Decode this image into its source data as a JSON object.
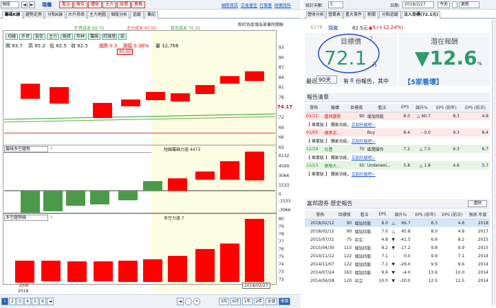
{
  "app": {
    "stock_name": "瑞儀",
    "mkt_label": "個股",
    "arrow_buttons": [
      "◄",
      "►"
    ],
    "red_buttons": [
      "看法",
      "報告",
      "體檢",
      "主力",
      "股價",
      "氣報"
    ],
    "links": [
      "國際資訊",
      "交易量佳",
      "行事曆",
      "財團資料"
    ]
  },
  "left_tabs": [
    "籌碼K線",
    "趨勢走勢",
    "分點K線",
    "大戶券商",
    "主力地圖",
    "個股分析",
    "追蹤",
    "筆記"
  ],
  "chart_legend": {
    "items": [
      "外資成本 68.70",
      "主力成本 65.50",
      "投信成本 70.31"
    ],
    "note": "粉紅色區塊為單筆所關聯"
  },
  "chart_buttons": [
    "均線",
    "外資",
    "投信",
    "主力",
    "融資",
    "布林",
    "籌碼",
    "紅綠燈",
    "設"
  ],
  "ohlc": {
    "open": "開 83.7",
    "high": "高 85.2",
    "low": "低 82.5",
    "close": "收 82.5",
    "chg": "漲跌 0.3",
    "pct": "漲幅 0.36%",
    "vol": "量 12,768",
    "tip": "90.00"
  },
  "price_axis": [
    "93",
    "90",
    "87",
    "84",
    "81",
    "78",
    "72",
    "69",
    "66",
    "63"
  ],
  "current_price": "74.17",
  "pane2": {
    "select": "籌碼多空趨勢",
    "legend": "短線籌碼力道 4473",
    "ticks": [
      "6132",
      "4599",
      "3066",
      "1533",
      "0",
      "-1533",
      "-3066"
    ]
  },
  "pane3": {
    "select": "多空趨勢線",
    "legend": "多空力道 7",
    "ticks": [
      "80",
      "79",
      "78",
      "77",
      "76",
      "75",
      "74",
      "73",
      "72"
    ]
  },
  "date_axis": {
    "left": "2/06",
    "left_year": "2018",
    "cursor": "2018/02/27"
  },
  "bottom": {
    "pages": [
      "1",
      "2",
      "3",
      "4",
      "5",
      "6"
    ],
    "ranges": [
      "3月",
      "6月",
      "1年",
      "2年",
      "全部",
      "復價"
    ],
    "misc": [
      "◄",
      "-",
      "+",
      "◄"
    ]
  },
  "right": {
    "stat_label": "統計天數:",
    "stat_value": "5",
    "date_label": "日期:",
    "date_value": "2018/2/27",
    "today_btn": "今天",
    "refresh_btn": "更新",
    "tabs": [
      "營收分析",
      "營業表",
      "重大事件",
      "新聞",
      "分點追蹤",
      "法人目標(72.1元)"
    ],
    "stock_line": {
      "code": "6176",
      "name": "瑞儀",
      "price": "82.5元",
      "change": "▲9 (+12.24%)"
    },
    "target_title": "目標價",
    "target_q": "?",
    "target_value": "72.1",
    "target_unit": "元",
    "upside_title": "潛在報酬",
    "upside_value": "▼12.6",
    "upside_unit": "%",
    "filter": {
      "recent": "最近",
      "days": "90天",
      "have": "有",
      "count": "8",
      "phrase": "份報告，其中",
      "buy_label": "【5家看壞】"
    },
    "report_list_title": "報告清單",
    "report_cols": [
      "發佈",
      "機構",
      "目標價",
      "看法",
      "EPS",
      "調升%",
      "EPS (前年)",
      "EPS (前次)"
    ],
    "reports": [
      {
        "date": "02/12",
        "org": "富邦證券",
        "target": "90",
        "view": "增加持股",
        "eps": "8.0",
        "arrow": "△",
        "chg": "66.7",
        "eps_prev_year": "8.3",
        "eps_prev": "4.8"
      },
      {
        "promo": "【 專業版 】 獨家功能，",
        "link": "立刻升級吧~"
      },
      {
        "date": "01/05",
        "org": "德意志...",
        "target": "",
        "view": "Buy",
        "eps": "8.4",
        "arrow": "-",
        "chg": "0.0",
        "eps_prev_year": "9.3",
        "eps_prev": "8.4"
      },
      {
        "promo": "【 專業版 】 獨家功能，",
        "link": "立刻升級吧~"
      },
      {
        "date": "12/28",
        "org": "兆豐",
        "target": "70",
        "view": "區間操作",
        "eps": "7.2",
        "arrow": "△",
        "chg": "7.5",
        "eps_prev_year": "6.3",
        "eps_prev": "6.7"
      },
      {
        "promo": "【 專業版 】 獨家功能，",
        "link": "立刻升級吧~"
      },
      {
        "date": "12/13",
        "org": "摩根大...",
        "target": "50",
        "view": "Underwei...",
        "eps": "5.8",
        "arrow": "△",
        "chg": "1.8",
        "eps_prev_year": "4.6",
        "eps_prev": "5.7"
      },
      {
        "promo": "【 專業版 】 獨家功能，",
        "link": "立刻升級吧~"
      }
    ],
    "history_title": "富邦證券 歷史報告",
    "clear_btn": "清除",
    "history_cols": [
      "發佈",
      "目標價",
      "看法",
      "EPS",
      "調升%",
      "EPS (前年)",
      "EPS (前次)",
      "預測 年度"
    ],
    "history": [
      [
        "2018/02/12",
        "90",
        "增加持股",
        "8.0",
        "△",
        "66.7",
        "8.3",
        "4.8",
        "2018"
      ],
      [
        "2018/02/12",
        "90",
        "增加持股",
        "7.0",
        "△",
        "45.8",
        "8.0",
        "4.8",
        "2017"
      ],
      [
        "2015/07/31",
        "75",
        "中立",
        "4.8",
        "▼",
        "-41.5",
        "6.6",
        "8.2",
        "2015"
      ],
      [
        "2015/04/30",
        "115",
        "增加持股",
        "8.2",
        "▼",
        "-17.2",
        "9.8",
        "9.9",
        "2015"
      ],
      [
        "2014/11/12",
        "122",
        "增加持股",
        "7.1",
        "-",
        "0.0",
        "9.9",
        "7.1",
        "2014"
      ],
      [
        "2014/11/07",
        "122",
        "增加持股",
        "7.1",
        "▼",
        "-26.0",
        "9.9",
        "9.6",
        "2014"
      ],
      [
        "2014/07/24",
        "163",
        "增加持股",
        "9.6",
        "▼",
        "-4.0",
        "13.6",
        "10.0",
        "2014"
      ],
      [
        "2014/04/28",
        "120",
        "中立",
        "10.0",
        "▼",
        "-20.0",
        "12.5",
        "12.5",
        "2014"
      ]
    ]
  },
  "chart_data": [
    {
      "type": "bar",
      "title": "",
      "categories": [
        "1",
        "2",
        "3",
        "4",
        "5",
        "6",
        "7",
        "8",
        "9",
        "10"
      ],
      "series": [
        {
          "values": [
            [
              86,
              84
            ],
            [
              86,
              83
            ],
            [
              85,
              80
            ],
            [
              84,
              81
            ],
            [
              84,
              83
            ],
            [
              83,
              81
            ],
            [
              81,
              83
            ],
            [
              82,
              84
            ],
            [
              83,
              85
            ],
            [
              84,
              86
            ]
          ]
        }
      ],
      "ylim": [
        63,
        93
      ]
    },
    {
      "type": "bar",
      "categories": [
        "1",
        "2",
        "3",
        "4",
        "5",
        "6",
        "7",
        "8",
        "9",
        "10"
      ],
      "series": [
        {
          "name": "短線籌碼力道",
          "values": [
            -2300,
            -2200,
            -1700,
            -1500,
            -1100,
            -700,
            -600,
            300,
            1100,
            2600,
            4473
          ]
        }
      ],
      "ylim": [
        -3066,
        6132
      ]
    },
    {
      "type": "bar",
      "categories": [
        "1",
        "2",
        "3",
        "4",
        "5",
        "6",
        "7",
        "8",
        "9",
        "10",
        "11"
      ],
      "series": [
        {
          "name": "多空力道",
          "values": [
            74.2,
            74.1,
            74.2,
            74.0,
            74.1,
            74.2,
            75.3,
            76.3,
            77.4,
            78.2,
            80.1
          ]
        }
      ],
      "ylim": [
        72,
        80
      ]
    }
  ]
}
